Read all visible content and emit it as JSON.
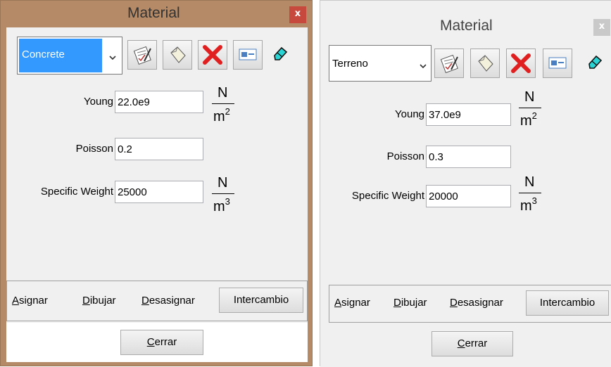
{
  "left_window": {
    "title": "Material",
    "close_glyph": "x",
    "material_selected": "Concrete",
    "young_label": "Young",
    "young_value": "22.0e9",
    "poisson_label": "Poisson",
    "poisson_value": "0.2",
    "weight_label": "Specific Weight",
    "weight_value": "25000",
    "unit_numerator": "N",
    "unit_base": "m",
    "young_unit_exp": "2",
    "weight_unit_exp": "3",
    "asignar": {
      "underlined": "A",
      "rest": "signar"
    },
    "dibujar": {
      "underlined": "D",
      "rest": "ibujar"
    },
    "desasignar": {
      "underlined": "D",
      "rest": "esasignar"
    },
    "intercambio_label": "Intercambio",
    "cerrar": {
      "underlined": "C",
      "rest": "errar"
    },
    "colors": {
      "frame": "#b58a66",
      "close_bg": "#c7493e",
      "selection": "#3399ff"
    }
  },
  "right_window": {
    "title": "Material",
    "close_glyph": "x",
    "material_selected": "Terreno",
    "young_label": "Young",
    "young_value": "37.0e9",
    "poisson_label": "Poisson",
    "poisson_value": "0.3",
    "weight_label": "Specific Weight",
    "weight_value": "20000",
    "unit_numerator": "N",
    "unit_base": "m",
    "young_unit_exp": "2",
    "weight_unit_exp": "3",
    "asignar": {
      "underlined": "A",
      "rest": "signar"
    },
    "dibujar": {
      "underlined": "D",
      "rest": "ibujar"
    },
    "desasignar": {
      "underlined": "D",
      "rest": "esasignar"
    },
    "intercambio_label": "Intercambio",
    "cerrar": {
      "underlined": "C",
      "rest": "errar"
    },
    "colors": {
      "frame": "#f0f0f0",
      "close_bg": "#c9c9c9"
    }
  },
  "toolbar_icons": [
    "edit-material-icon",
    "new-material-icon",
    "delete-icon",
    "properties-icon",
    "eraser-icon"
  ]
}
